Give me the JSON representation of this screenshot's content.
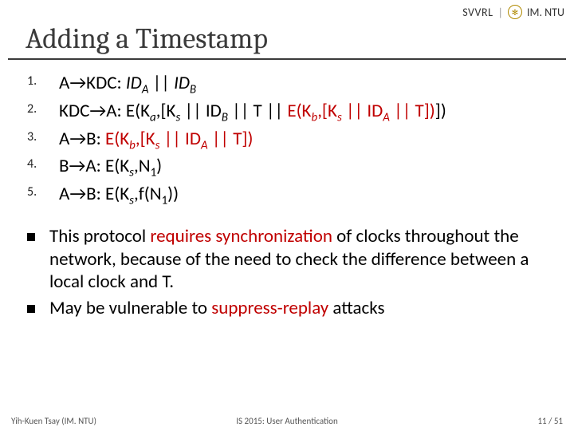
{
  "header": {
    "org": "SVVRL",
    "affil": "IM. NTU"
  },
  "title": "Adding a Timestamp",
  "steps": [
    {
      "lhs": "A",
      "rhs": "KDC",
      "msg_parts": [
        "ID",
        "A",
        " || ",
        "ID",
        "B"
      ]
    },
    {
      "lhs": "KDC",
      "rhs": "A",
      "msg_plain": "E(K",
      "sub1": "a",
      "msg_mid": ",[K",
      "sub2": "s",
      "msg_mid2": " || ID",
      "sub3": "B",
      "msg_mid3": " || T || ",
      "inner_red": "E(K",
      "sub4": "b",
      "inner_red2": ",[K",
      "sub5": "s",
      "inner_red3": " || ID",
      "sub6": "A",
      "inner_red4": " || T])",
      "msg_end": "])"
    },
    {
      "lhs": "A",
      "rhs": "B",
      "red_prefix": "E(K",
      "sub1": "b",
      "red_mid": ",[K",
      "sub2": "s",
      "red_mid2": " || ID",
      "sub3": "A",
      "red_end": " || T])"
    },
    {
      "lhs": "B",
      "rhs": "A",
      "body": "E(K",
      "sub1": "s",
      "body2": ",N",
      "sub2": "1",
      "body3": ")"
    },
    {
      "lhs": "A",
      "rhs": "B",
      "body": "E(K",
      "sub1": "s",
      "body2": ",f(N",
      "sub2": "1",
      "body3": "))"
    }
  ],
  "notes": [
    {
      "pre": "This protocol ",
      "red": "requires synchronization",
      "post": " of clocks throughout the network, because of the need to check the difference between a local clock and T."
    },
    {
      "pre": "May be vulnerable to ",
      "red": "suppress-replay",
      "post": " attacks"
    }
  ],
  "footer": {
    "left": "Yih-Kuen Tsay (IM. NTU)",
    "mid": "IS 2015: User Authentication",
    "right": "11 / 51"
  }
}
